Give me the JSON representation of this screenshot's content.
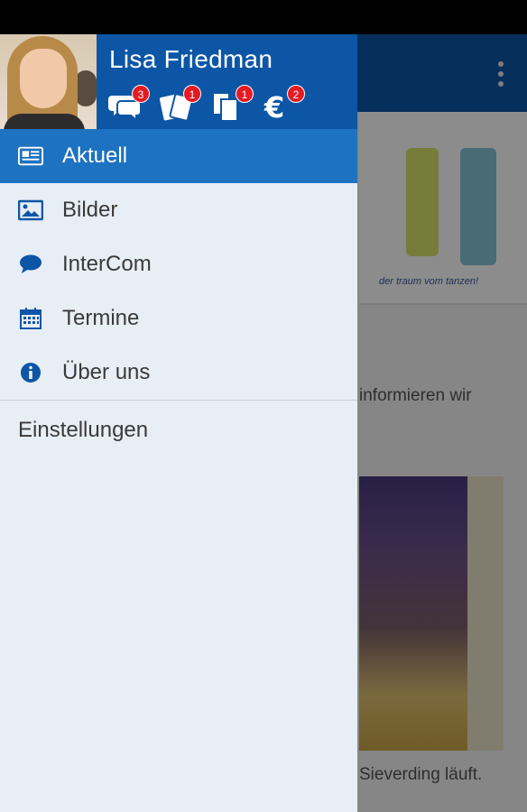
{
  "profile": {
    "name": "Lisa Friedman",
    "stats": [
      {
        "icon": "chat-icon",
        "count": "3"
      },
      {
        "icon": "tickets-icon",
        "count": "1"
      },
      {
        "icon": "documents-icon",
        "count": "1"
      },
      {
        "icon": "euro-icon",
        "count": "2"
      }
    ]
  },
  "menu": {
    "items": [
      {
        "label": "Aktuell",
        "icon": "newspaper-icon",
        "active": true
      },
      {
        "label": "Bilder",
        "icon": "image-icon",
        "active": false
      },
      {
        "label": "InterCom",
        "icon": "speech-bubble-icon",
        "active": false
      },
      {
        "label": "Termine",
        "icon": "calendar-icon",
        "active": false
      },
      {
        "label": "Über uns",
        "icon": "info-icon",
        "active": false
      }
    ],
    "settings_label": "Einstellungen"
  },
  "background": {
    "banner_caption": "der traum vom tanzen!",
    "text_line_1": "informieren wir",
    "text_line_2": "Sieverding läuft."
  },
  "colors": {
    "primary": "#0d56a6",
    "active_item": "#1e72c2",
    "drawer_bg": "#e8eef6",
    "badge": "#e31b23"
  }
}
